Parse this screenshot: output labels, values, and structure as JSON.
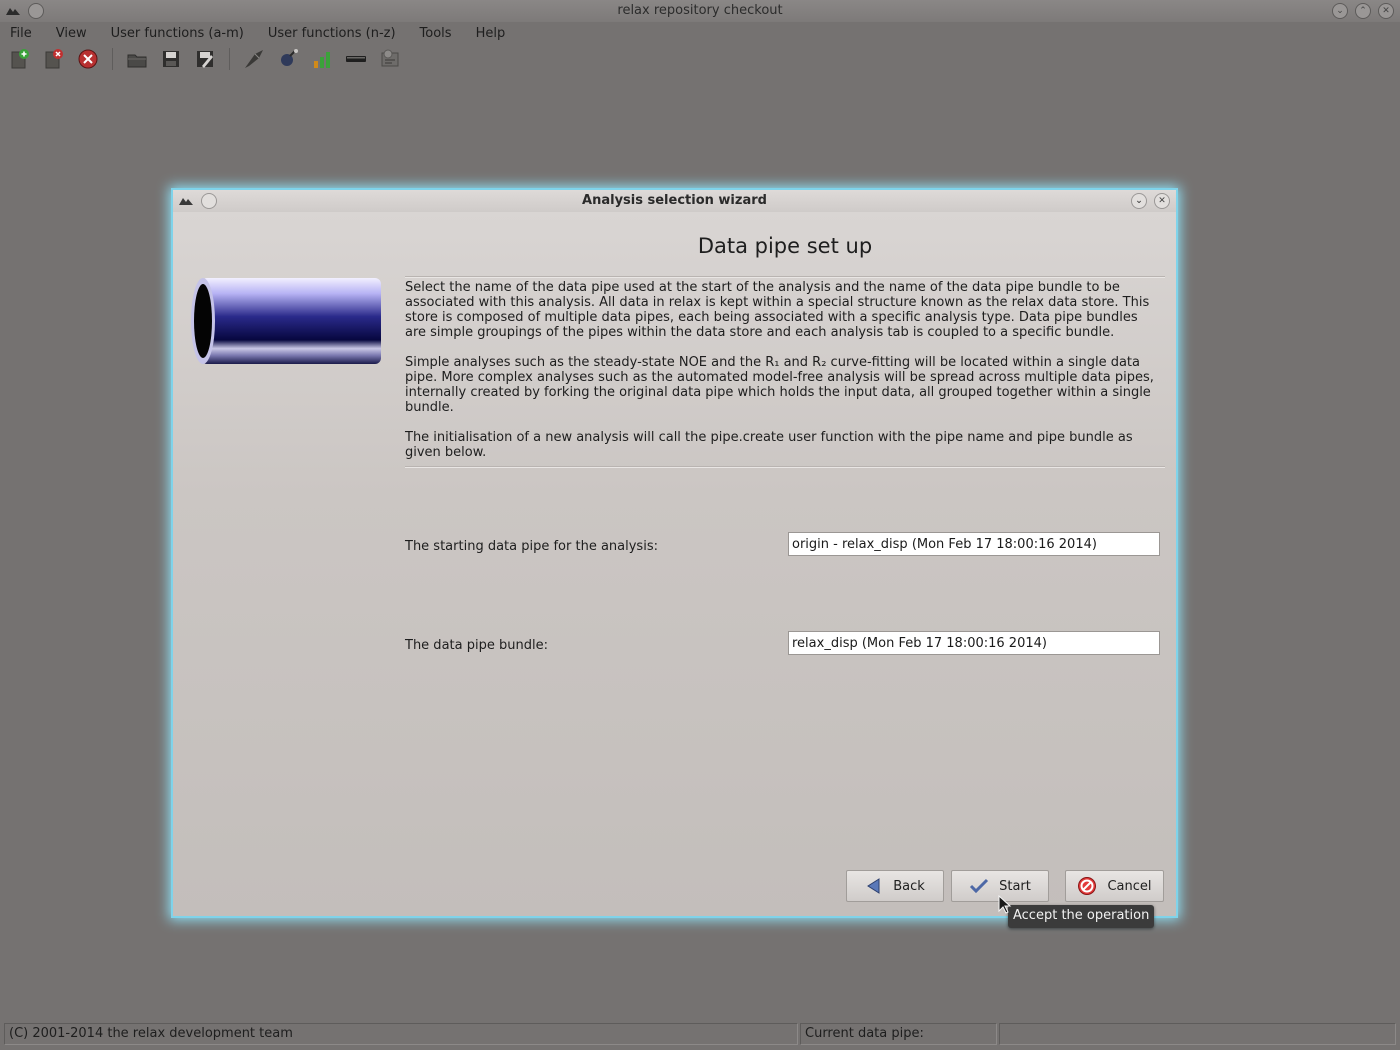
{
  "window": {
    "title": "relax repository checkout"
  },
  "menubar": {
    "items": [
      "File",
      "View",
      "User functions (a-m)",
      "User functions (n-z)",
      "Tools",
      "Help"
    ]
  },
  "toolbar": {
    "icons": [
      "new-analysis-icon",
      "close-analysis-icon",
      "close-all-icon",
      "open-icon",
      "save-icon",
      "save-as-icon",
      "relax-spin-viewer-icon",
      "results-viewer-icon",
      "data-pipe-editor-icon",
      "prompt-icon",
      "script-icon"
    ]
  },
  "dialog": {
    "title": "Analysis selection wizard",
    "heading": "Data pipe set up",
    "paragraphs": [
      "Select the name of the data pipe used at the start of the analysis and the name of the data pipe bundle to be associated with this analysis.  All data in relax is kept within a special structure known as the relax data store.  This store is composed of multiple data pipes, each being associated with a specific analysis type.  Data pipe bundles are simple groupings of the pipes within the data store and each analysis tab is coupled to a specific bundle.",
      "Simple analyses such as the steady-state NOE and the R₁ and R₂ curve-fitting will be located within a single data pipe.  More complex analyses such as the automated model-free analysis will be spread across multiple data pipes, internally created by forking the original data pipe which holds the input data, all grouped together within a single bundle.",
      "The initialisation of a new analysis will call the pipe.create user function with the pipe name and pipe bundle as given below."
    ],
    "fields": {
      "starting_pipe_label": "The starting data pipe for the analysis:",
      "starting_pipe_value": "origin - relax_disp (Mon Feb 17 18:00:16 2014)",
      "bundle_label": "The data pipe bundle:",
      "bundle_value": "relax_disp (Mon Feb 17 18:00:16 2014)"
    },
    "buttons": {
      "back": "Back",
      "start": "Start",
      "cancel": "Cancel"
    },
    "tooltip": "Accept the operation"
  },
  "statusbar": {
    "copyright": "(C) 2001-2014 the relax development team",
    "current_pipe_label": "Current data pipe:",
    "current_pipe_value": ""
  }
}
